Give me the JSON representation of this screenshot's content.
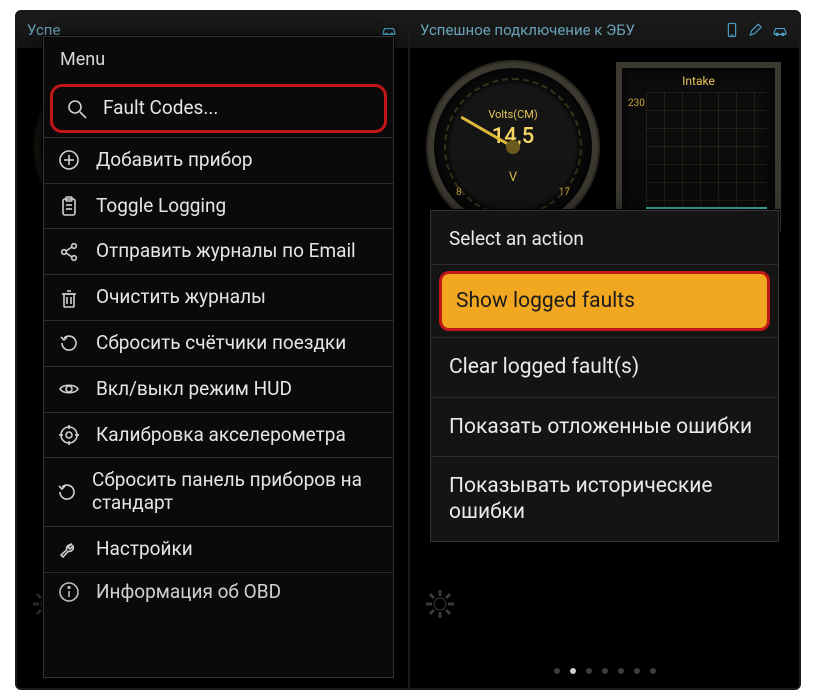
{
  "phone1": {
    "status_title": "Успе",
    "menu_title": "Menu",
    "items": [
      {
        "icon": "search",
        "label": "Fault Codes...",
        "hl": true
      },
      {
        "icon": "plus",
        "label": "Добавить прибор"
      },
      {
        "icon": "clip",
        "label": "Toggle Logging"
      },
      {
        "icon": "share",
        "label": "Отправить журналы по Email"
      },
      {
        "icon": "trash",
        "label": "Очистить журналы"
      },
      {
        "icon": "reset",
        "label": "Сбросить счётчики поездки"
      },
      {
        "icon": "eye",
        "label": "Вкл/выкл режим HUD"
      },
      {
        "icon": "target",
        "label": "Калибровка акселерометра"
      },
      {
        "icon": "reset",
        "label": "Сбросить панель приборов на стандарт"
      },
      {
        "icon": "wrench",
        "label": "Настройки"
      },
      {
        "icon": "info",
        "label": "Информация об OBD",
        "cut": true
      }
    ]
  },
  "phone2": {
    "status_title": "Успешное подключение к ЭБУ",
    "gauge": {
      "label": "Volts(CM)",
      "value": "14,5",
      "unit": "V",
      "min": "8",
      "max": "17"
    },
    "chart": {
      "title": "Intake",
      "ymax": "230"
    },
    "dialog_title": "Select an action",
    "actions": [
      {
        "label": "Show logged faults",
        "selected": true
      },
      {
        "label": "Clear logged fault(s)"
      },
      {
        "label": "Показать отложенные ошибки"
      },
      {
        "label": "Показывать исторические ошибки"
      }
    ]
  }
}
